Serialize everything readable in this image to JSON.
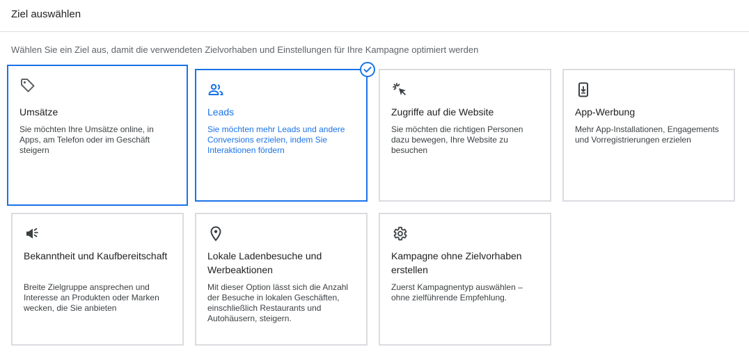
{
  "header": {
    "title": "Ziel auswählen"
  },
  "subtitle": "Wählen Sie ein Ziel aus, damit die verwendeten Zielvorhaben und Einstellungen für Ihre Kampagne optimiert werden",
  "colors": {
    "accent": "#1a73e8",
    "border": "#dadce0",
    "text": "#202124",
    "muted": "#5f6368"
  },
  "goals": [
    {
      "icon": "tag-icon",
      "title": "Umsätze",
      "description": "Sie möchten Ihre Umsätze online, in Apps, am Telefon oder im Geschäft steigern"
    },
    {
      "icon": "people-icon",
      "title": "Leads",
      "description": "Sie möchten mehr Leads und andere Conversions erzielen, indem Sie Interaktionen fördern",
      "selected": true
    },
    {
      "icon": "cursor-click-icon",
      "title": "Zugriffe auf die Website",
      "description": "Sie möchten die richtigen Personen dazu bewegen, Ihre Website zu besuchen"
    },
    {
      "icon": "phone-download-icon",
      "title": "App-Werbung",
      "description": "Mehr App-Installationen, Engagements und Vorregistrierungen erzielen"
    },
    {
      "icon": "megaphone-icon",
      "title": "Bekanntheit und Kaufbereitschaft",
      "description": "Breite Zielgruppe ansprechen und Interesse an Produkten oder Marken wecken, die Sie anbieten"
    },
    {
      "icon": "location-pin-icon",
      "title": "Lokale Ladenbesuche und Werbeaktionen",
      "description": "Mit dieser Option lässt sich die Anzahl der Besuche in lokalen Geschäften, einschließlich Restaurants und Autohäusern, steigern."
    },
    {
      "icon": "gear-icon",
      "title": "Kampagne ohne Zielvorhaben erstellen",
      "description": "Zuerst Kampagnentyp auswählen – ohne zielführende Empfehlung."
    }
  ]
}
